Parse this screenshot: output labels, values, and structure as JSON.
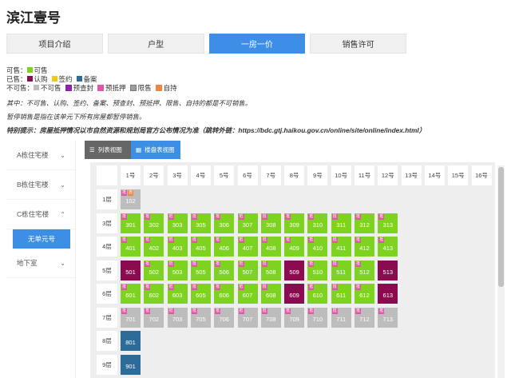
{
  "page": {
    "title": "滨江壹号"
  },
  "tabs": [
    "项目介绍",
    "户型",
    "一房一价",
    "销售许可"
  ],
  "legend": {
    "sellable_label": "可售：",
    "sellable": {
      "label": "可售",
      "color": "#7ed321"
    },
    "sold_label": "已售：",
    "sold": [
      {
        "label": "认购",
        "color": "#8b0a50"
      },
      {
        "label": "签约",
        "color": "#f5c518"
      },
      {
        "label": "备案",
        "color": "#2d6b9a"
      }
    ],
    "unsellable_label": "不可售：",
    "unsellable": [
      {
        "label": "不可售",
        "color": "#bdbdbd"
      },
      {
        "label": "预查封",
        "color": "#8e24aa"
      },
      {
        "label": "预抵押",
        "color": "#e057a6"
      },
      {
        "label": "限售",
        "color": "#9e9e9e"
      },
      {
        "label": "自持",
        "color": "#f0873c"
      }
    ]
  },
  "notes": [
    "其中：不可售、认购、签约、备案、预查封、预抵押、限售、自持的都是不可销售。",
    "暂停销售是指在该单元下所有房屋都暂停销售。",
    "特别提示：房屋抵押情况以市自然资源和规划局官方公布情况为准（跳转外链：https://bdc.gtj.haikou.gov.cn/online/site/online/index.html）"
  ],
  "sidebar": {
    "buildings": [
      "A栋住宅楼",
      "B栋住宅楼",
      "C栋住宅楼"
    ],
    "selected_unit": "无单元号",
    "basement": "地下室"
  },
  "view_buttons": {
    "list": "列表视图",
    "map": "楼盘表视图"
  },
  "grid": {
    "columns": [
      "1号",
      "2号",
      "3号",
      "4号",
      "5号",
      "6号",
      "7号",
      "8号",
      "9号",
      "10号",
      "11号",
      "12号",
      "13号",
      "14号",
      "15号",
      "16号"
    ],
    "tags": {
      "pre": "抵",
      "own": "自"
    },
    "rows": [
      {
        "label": "1层",
        "units": [
          {
            "col": 0,
            "no": "102",
            "status": "unavailable",
            "tags": [
              "pre",
              "own"
            ]
          }
        ]
      },
      {
        "label": "3层",
        "units": [
          {
            "col": 0,
            "no": "301",
            "status": "available",
            "tags": [
              "pre"
            ]
          },
          {
            "col": 1,
            "no": "302",
            "status": "available",
            "tags": [
              "pre"
            ]
          },
          {
            "col": 2,
            "no": "303",
            "status": "available",
            "tags": [
              "pre"
            ]
          },
          {
            "col": 3,
            "no": "305",
            "status": "available",
            "tags": [
              "pre"
            ]
          },
          {
            "col": 4,
            "no": "306",
            "status": "available",
            "tags": [
              "pre"
            ]
          },
          {
            "col": 5,
            "no": "307",
            "status": "available",
            "tags": [
              "pre"
            ]
          },
          {
            "col": 6,
            "no": "308",
            "status": "available",
            "tags": [
              "pre"
            ]
          },
          {
            "col": 7,
            "no": "309",
            "status": "available",
            "tags": [
              "pre"
            ]
          },
          {
            "col": 8,
            "no": "310",
            "status": "available",
            "tags": [
              "pre"
            ]
          },
          {
            "col": 9,
            "no": "311",
            "status": "available",
            "tags": [
              "pre"
            ]
          },
          {
            "col": 10,
            "no": "312",
            "status": "available",
            "tags": [
              "pre"
            ]
          },
          {
            "col": 11,
            "no": "313",
            "status": "available",
            "tags": [
              "pre"
            ]
          }
        ]
      },
      {
        "label": "4层",
        "units": [
          {
            "col": 0,
            "no": "401",
            "status": "available",
            "tags": [
              "pre"
            ]
          },
          {
            "col": 1,
            "no": "402",
            "status": "available",
            "tags": [
              "pre"
            ]
          },
          {
            "col": 2,
            "no": "403",
            "status": "available",
            "tags": [
              "pre"
            ]
          },
          {
            "col": 3,
            "no": "405",
            "status": "available",
            "tags": [
              "pre"
            ]
          },
          {
            "col": 4,
            "no": "406",
            "status": "available",
            "tags": [
              "pre"
            ]
          },
          {
            "col": 5,
            "no": "407",
            "status": "available",
            "tags": [
              "pre"
            ]
          },
          {
            "col": 6,
            "no": "408",
            "status": "available",
            "tags": [
              "pre"
            ]
          },
          {
            "col": 7,
            "no": "409",
            "status": "available",
            "tags": [
              "pre"
            ]
          },
          {
            "col": 8,
            "no": "410",
            "status": "available",
            "tags": [
              "pre"
            ]
          },
          {
            "col": 9,
            "no": "411",
            "status": "available",
            "tags": [
              "pre"
            ]
          },
          {
            "col": 10,
            "no": "412",
            "status": "available",
            "tags": [
              "pre"
            ]
          },
          {
            "col": 11,
            "no": "413",
            "status": "available",
            "tags": [
              "pre"
            ]
          }
        ]
      },
      {
        "label": "5层",
        "units": [
          {
            "col": 0,
            "no": "501",
            "status": "sold",
            "tags": []
          },
          {
            "col": 1,
            "no": "502",
            "status": "available",
            "tags": [
              "pre"
            ]
          },
          {
            "col": 2,
            "no": "503",
            "status": "available",
            "tags": [
              "pre"
            ]
          },
          {
            "col": 3,
            "no": "505",
            "status": "available",
            "tags": [
              "pre"
            ]
          },
          {
            "col": 4,
            "no": "506",
            "status": "available",
            "tags": [
              "pre"
            ]
          },
          {
            "col": 5,
            "no": "507",
            "status": "available",
            "tags": [
              "pre"
            ]
          },
          {
            "col": 6,
            "no": "508",
            "status": "available",
            "tags": [
              "pre"
            ]
          },
          {
            "col": 7,
            "no": "509",
            "status": "sold",
            "tags": []
          },
          {
            "col": 8,
            "no": "510",
            "status": "available",
            "tags": [
              "pre"
            ]
          },
          {
            "col": 9,
            "no": "511",
            "status": "available",
            "tags": [
              "pre"
            ]
          },
          {
            "col": 10,
            "no": "512",
            "status": "available",
            "tags": [
              "pre"
            ]
          },
          {
            "col": 11,
            "no": "513",
            "status": "sold",
            "tags": []
          }
        ]
      },
      {
        "label": "6层",
        "units": [
          {
            "col": 0,
            "no": "601",
            "status": "available",
            "tags": [
              "pre"
            ]
          },
          {
            "col": 1,
            "no": "602",
            "status": "available",
            "tags": [
              "pre"
            ]
          },
          {
            "col": 2,
            "no": "603",
            "status": "available",
            "tags": [
              "pre"
            ]
          },
          {
            "col": 3,
            "no": "605",
            "status": "available",
            "tags": [
              "pre"
            ]
          },
          {
            "col": 4,
            "no": "606",
            "status": "available",
            "tags": [
              "pre"
            ]
          },
          {
            "col": 5,
            "no": "607",
            "status": "available",
            "tags": [
              "pre"
            ]
          },
          {
            "col": 6,
            "no": "608",
            "status": "available",
            "tags": [
              "pre"
            ]
          },
          {
            "col": 7,
            "no": "609",
            "status": "sold",
            "tags": []
          },
          {
            "col": 8,
            "no": "610",
            "status": "available",
            "tags": [
              "pre"
            ]
          },
          {
            "col": 9,
            "no": "611",
            "status": "available",
            "tags": [
              "pre"
            ]
          },
          {
            "col": 10,
            "no": "612",
            "status": "available",
            "tags": [
              "pre"
            ]
          },
          {
            "col": 11,
            "no": "613",
            "status": "sold",
            "tags": []
          }
        ]
      },
      {
        "label": "7层",
        "units": [
          {
            "col": 0,
            "no": "701",
            "status": "unavailable",
            "tags": [
              "pre"
            ]
          },
          {
            "col": 1,
            "no": "702",
            "status": "unavailable",
            "tags": [
              "pre"
            ]
          },
          {
            "col": 2,
            "no": "703",
            "status": "unavailable",
            "tags": [
              "pre"
            ]
          },
          {
            "col": 3,
            "no": "705",
            "status": "unavailable",
            "tags": [
              "pre"
            ]
          },
          {
            "col": 4,
            "no": "706",
            "status": "unavailable",
            "tags": [
              "pre"
            ]
          },
          {
            "col": 5,
            "no": "707",
            "status": "unavailable",
            "tags": [
              "pre"
            ]
          },
          {
            "col": 6,
            "no": "708",
            "status": "unavailable",
            "tags": [
              "pre"
            ]
          },
          {
            "col": 7,
            "no": "709",
            "status": "unavailable",
            "tags": [
              "pre"
            ]
          },
          {
            "col": 8,
            "no": "710",
            "status": "unavailable",
            "tags": [
              "pre"
            ]
          },
          {
            "col": 9,
            "no": "711",
            "status": "unavailable",
            "tags": [
              "pre"
            ]
          },
          {
            "col": 10,
            "no": "712",
            "status": "unavailable",
            "tags": [
              "pre"
            ]
          },
          {
            "col": 11,
            "no": "713",
            "status": "unavailable",
            "tags": [
              "pre"
            ]
          }
        ]
      },
      {
        "label": "8层",
        "units": [
          {
            "col": 0,
            "no": "801",
            "status": "filed",
            "tags": []
          }
        ]
      },
      {
        "label": "9层",
        "units": [
          {
            "col": 0,
            "no": "901",
            "status": "filed",
            "tags": []
          }
        ]
      }
    ]
  }
}
